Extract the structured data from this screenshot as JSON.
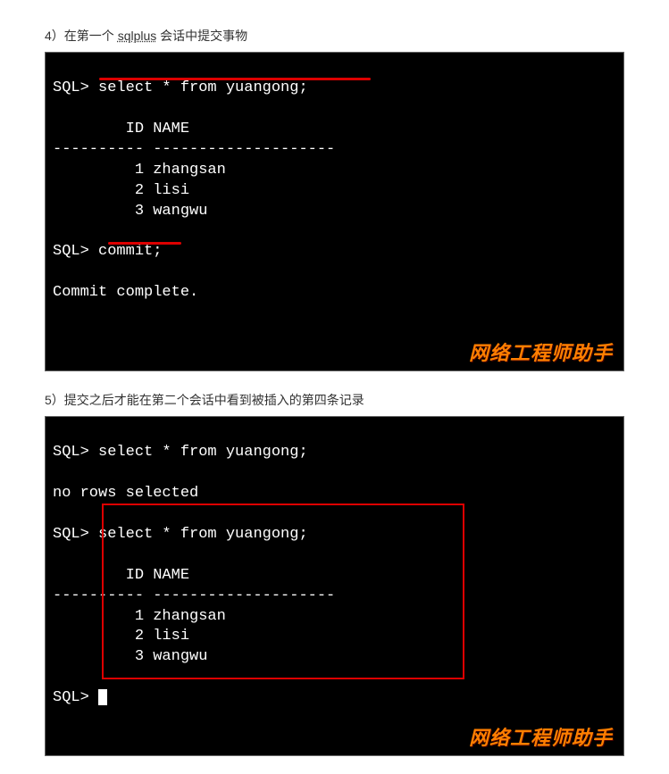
{
  "section1": {
    "caption_prefix": "4）在第一个 ",
    "caption_underline": "sqlplus",
    "caption_suffix": " 会话中提交事物",
    "terminal": {
      "prompt1": "SQL> ",
      "cmd1": "select * from yuangong;",
      "blank": "",
      "header": "        ID NAME",
      "divider": "---------- --------------------",
      "rows": [
        "         1 zhangsan",
        "         2 lisi",
        "         3 wangwu"
      ],
      "prompt2": "SQL> ",
      "cmd2": "commit;",
      "result": "Commit complete.",
      "watermark": "网络工程师助手"
    }
  },
  "section2": {
    "caption": "5）提交之后才能在第二个会话中看到被插入的第四条记录",
    "terminal": {
      "prompt1": "SQL> ",
      "cmd1": "select * from yuangong;",
      "blank": "",
      "norows": "no rows selected",
      "prompt2": "SQL> ",
      "cmd2": "select * from yuangong;",
      "header": "        ID NAME",
      "divider": "---------- --------------------",
      "rows": [
        "         1 zhangsan",
        "         2 lisi",
        "         3 wangwu"
      ],
      "prompt3": "SQL> ",
      "watermark": "网络工程师助手"
    }
  }
}
